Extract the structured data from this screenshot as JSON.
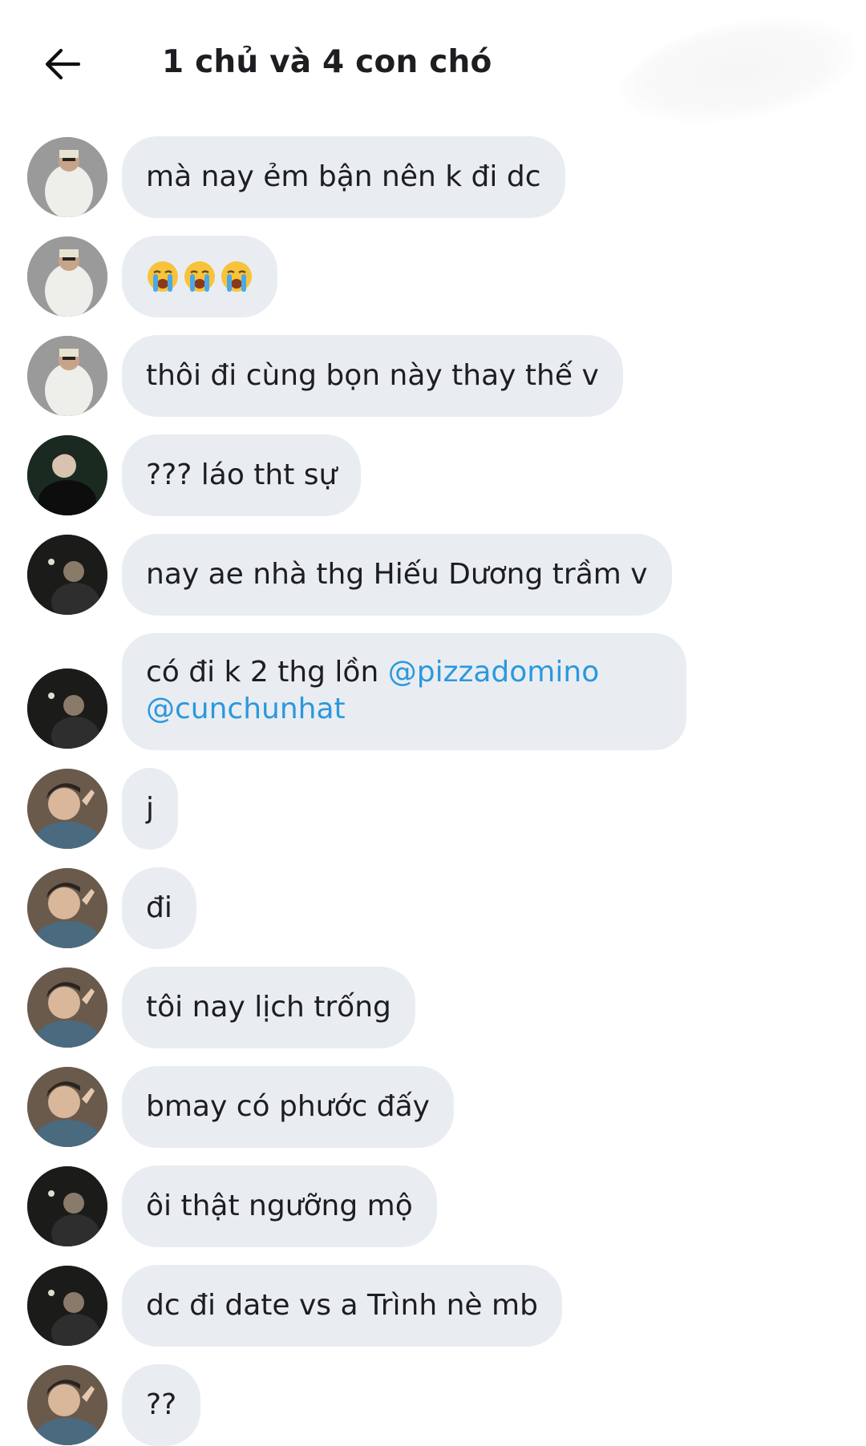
{
  "header": {
    "title": "1 chủ và 4 con chó",
    "back_icon": "arrow-left-icon"
  },
  "colors": {
    "bubble_bg": "#e9edf1",
    "mention": "#2b98de",
    "text": "#1c1e21"
  },
  "messages": [
    {
      "avatar": "avatar-user-a",
      "text": "mà nay ẻm bận nên k đi dc"
    },
    {
      "avatar": "avatar-user-a",
      "emoji": [
        "loudly-crying-face-icon",
        "loudly-crying-face-icon",
        "loudly-crying-face-icon"
      ]
    },
    {
      "avatar": "avatar-user-a",
      "text": "thôi đi cùng bọn này thay thế v"
    },
    {
      "avatar": "avatar-user-b",
      "text": "??? láo tht sự"
    },
    {
      "avatar": "avatar-user-c",
      "text": "nay ae nhà thg Hiếu Dương trầm v"
    },
    {
      "avatar": "avatar-user-c",
      "text_prefix": "có đi k 2 thg lồn",
      "mentions": [
        "@pizzadomino",
        "@cunchunhat"
      ]
    },
    {
      "avatar": "avatar-user-d",
      "text": "j"
    },
    {
      "avatar": "avatar-user-d",
      "text": "đi"
    },
    {
      "avatar": "avatar-user-d",
      "text": "tôi nay lịch trống"
    },
    {
      "avatar": "avatar-user-d",
      "text": "bmay có phước đấy"
    },
    {
      "avatar": "avatar-user-c",
      "text": "ôi thật ngưỡng mộ"
    },
    {
      "avatar": "avatar-user-c",
      "text": "dc đi date vs a Trình nè mb"
    },
    {
      "avatar": "avatar-user-d",
      "text": "??"
    }
  ]
}
